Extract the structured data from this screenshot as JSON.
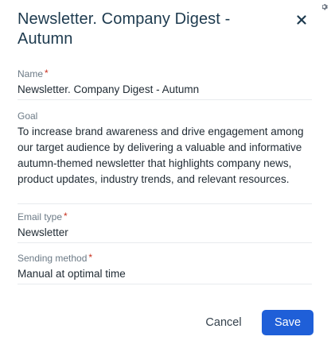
{
  "dialog": {
    "title": "Newsletter. Company Digest - Autumn",
    "close_icon": "close-icon",
    "settings_icon": "gear-icon"
  },
  "fields": {
    "name": {
      "label": "Name",
      "required": "*",
      "value": "Newsletter. Company Digest - Autumn"
    },
    "goal": {
      "label": "Goal",
      "value": "To increase brand awareness and drive engagement among our target audience by delivering a valuable and informative autumn-themed newsletter that highlights company news, product updates, industry trends, and relevant resources."
    },
    "email_type": {
      "label": "Email type",
      "required": "*",
      "value": "Newsletter"
    },
    "sending_method": {
      "label": "Sending method",
      "required": "*",
      "value": "Manual at optimal time"
    }
  },
  "footer": {
    "cancel_label": "Cancel",
    "save_label": "Save"
  },
  "colors": {
    "primary": "#1f5fd8",
    "title": "#1d3a4e",
    "required": "#c8301e",
    "label": "#6c7a86"
  }
}
